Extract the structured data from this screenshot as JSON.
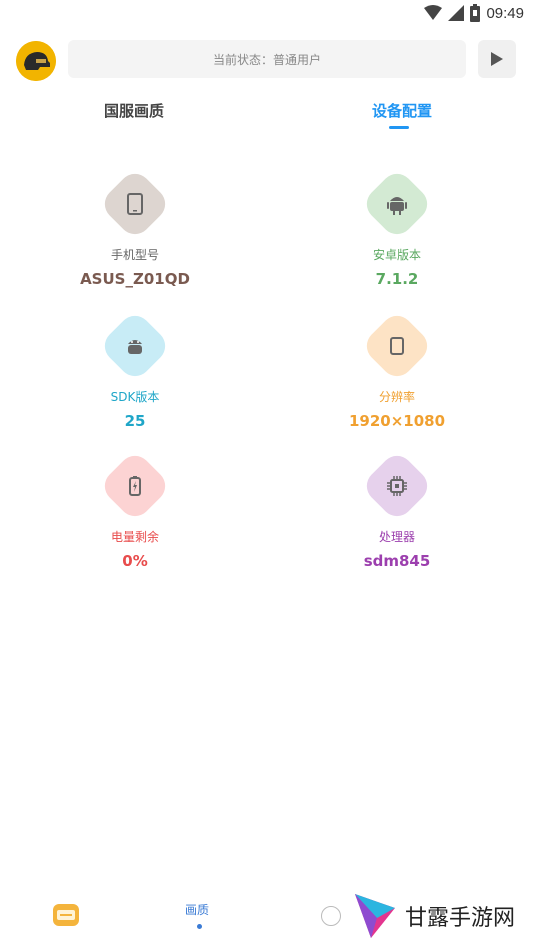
{
  "status_bar": {
    "time": "09:49"
  },
  "header": {
    "status_text": "当前状态：普通用户"
  },
  "tabs": [
    {
      "label": "国服画质",
      "active": false
    },
    {
      "label": "设备配置",
      "active": true
    }
  ],
  "device_info": [
    {
      "label": "手机型号",
      "value": "ASUS_Z01QD",
      "icon": "phone-icon",
      "color": "#7a5a50",
      "bg": "#ddd5d0"
    },
    {
      "label": "安卓版本",
      "value": "7.1.2",
      "icon": "android-icon",
      "color": "#5aa860",
      "bg": "#d3ead3"
    },
    {
      "label": "SDK版本",
      "value": "25",
      "icon": "android-robot-icon",
      "color": "#1fa6c8",
      "bg": "#c8ecf6"
    },
    {
      "label": "分辨率",
      "value": "1920×1080",
      "icon": "tablet-icon",
      "color": "#f0a030",
      "bg": "#fde3c5"
    },
    {
      "label": "电量剩余",
      "value": "0%",
      "icon": "battery-icon",
      "color": "#e84c4c",
      "bg": "#fcd3d3"
    },
    {
      "label": "处理器",
      "value": "sdm845",
      "icon": "cpu-icon",
      "color": "#9c3fae",
      "bg": "#e6d1ec"
    }
  ],
  "bottom_nav": {
    "quality_label": "画质"
  },
  "watermark": {
    "text": "甘露手游网"
  }
}
